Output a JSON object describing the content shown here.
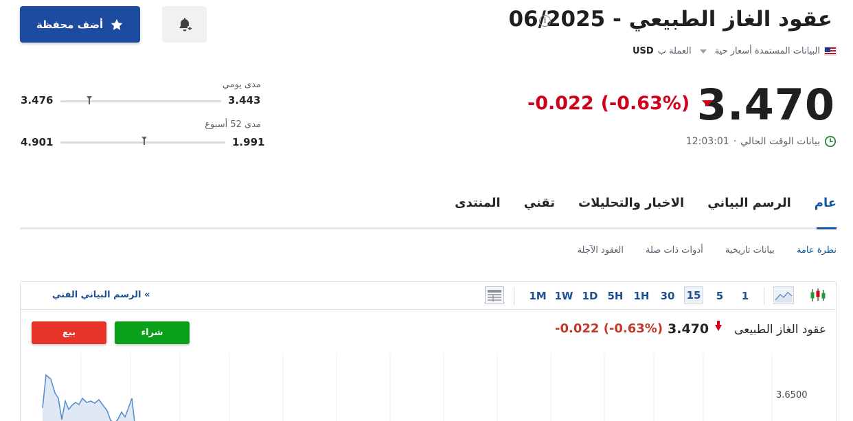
{
  "header": {
    "title": "عقود الغاز الطبيعي - 06/2025",
    "data_source_label": "البيانات المستمدة أسعار حية",
    "currency_label": "العملة ب",
    "currency_value": "USD",
    "add_portfolio_label": "أضف محفظة"
  },
  "quote": {
    "price": "3.470",
    "change": "-0.022",
    "change_pct": "(-0.63%)",
    "time_label": "بيانات الوقت الحالي",
    "time_value": "12:03:01",
    "time_separator": "·"
  },
  "ranges": {
    "daily": {
      "label": "مدى يومي",
      "low": "3.443",
      "high": "3.476",
      "position": 0.18
    },
    "week52": {
      "label": "مدى 52 أسبوع",
      "low": "1.991",
      "high": "4.901",
      "position": 0.51
    }
  },
  "tabs": [
    {
      "label": "عام",
      "active": true
    },
    {
      "label": "الرسم البياني",
      "active": false
    },
    {
      "label": "الاخبار والتحليلات",
      "active": false
    },
    {
      "label": "تقني",
      "active": false
    },
    {
      "label": "المنتدى",
      "active": false
    }
  ],
  "subtabs": [
    {
      "label": "نظرة عامة",
      "active": true
    },
    {
      "label": "بيانات تاريخية",
      "active": false
    },
    {
      "label": "أدوات ذات صلة",
      "active": false
    },
    {
      "label": "العقود الآجلة",
      "active": false
    }
  ],
  "chart_toolbar": {
    "timeframes": [
      "1",
      "5",
      "15",
      "30",
      "1H",
      "5H",
      "1D",
      "1W",
      "1M"
    ],
    "active_timeframe": "15",
    "tech_chart_link": "الرسم البياني الفني",
    "tech_chart_arrow": "»"
  },
  "chart_panel": {
    "instrument_name": "عقود الغاز الطبيعى",
    "price": "3.470",
    "change": "-0.022",
    "change_pct": "(-0.63%)",
    "buy_label": "شراء",
    "sell_label": "بيع",
    "y_axis_label": "3.6500"
  },
  "colors": {
    "brand_blue": "#1c4ba0",
    "link_blue": "#1256a0",
    "negative_red": "#d0021b",
    "buy_green": "#0aa01a",
    "sell_red": "#e8332b"
  },
  "icons": {
    "portfolio": "star-icon",
    "alert": "bell-plus-icon",
    "info": "info-icon",
    "clock": "clock-icon",
    "flag": "us-flag-icon",
    "line_chart": "line-chart-icon",
    "candles": "candlestick-icon",
    "table": "table-icon"
  }
}
